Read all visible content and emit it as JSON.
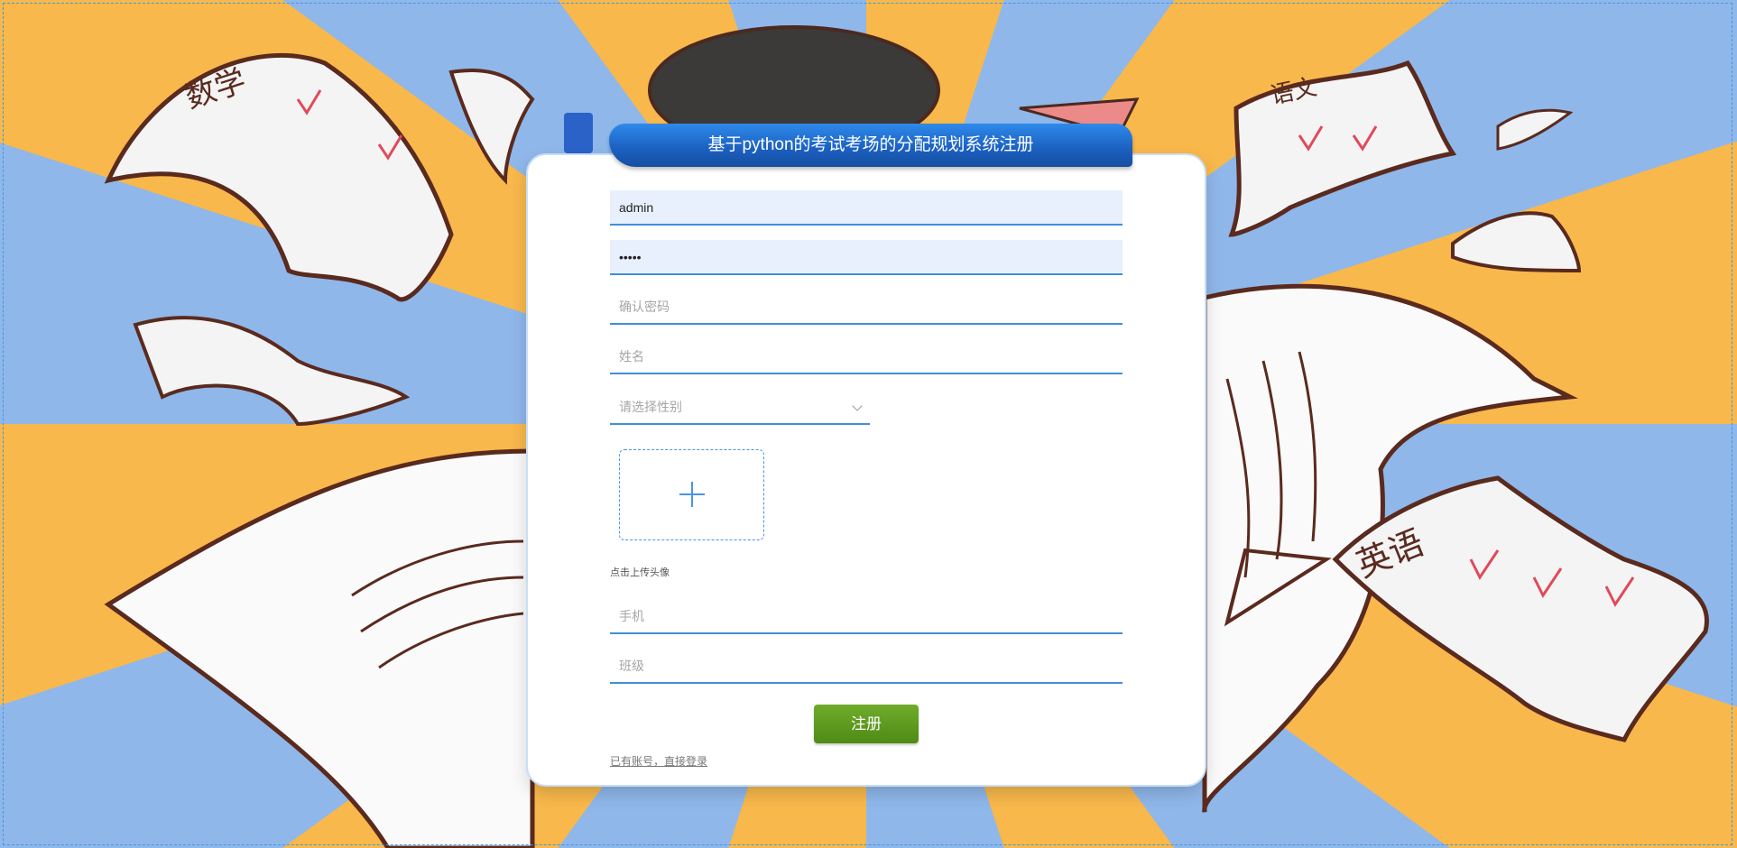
{
  "page": {
    "title": "基于python的考试考场的分配规划系统注册"
  },
  "form": {
    "username_value": "admin",
    "password_value": "•••••",
    "confirm_password_placeholder": "确认密码",
    "name_placeholder": "姓名",
    "gender_placeholder": "请选择性别",
    "upload_label": "点击上传头像",
    "phone_placeholder": "手机",
    "class_placeholder": "班级",
    "submit_label": "注册",
    "login_link": "已有账号，直接登录"
  },
  "background": {
    "paper_labels": [
      "数学",
      "语文",
      "英语"
    ]
  },
  "colors": {
    "accent": "#3f8fdd",
    "title_bar": "#1b5fc0",
    "button": "#5e9c20",
    "bg_orange": "#f8b84b",
    "bg_blue": "#8fb7ea"
  }
}
